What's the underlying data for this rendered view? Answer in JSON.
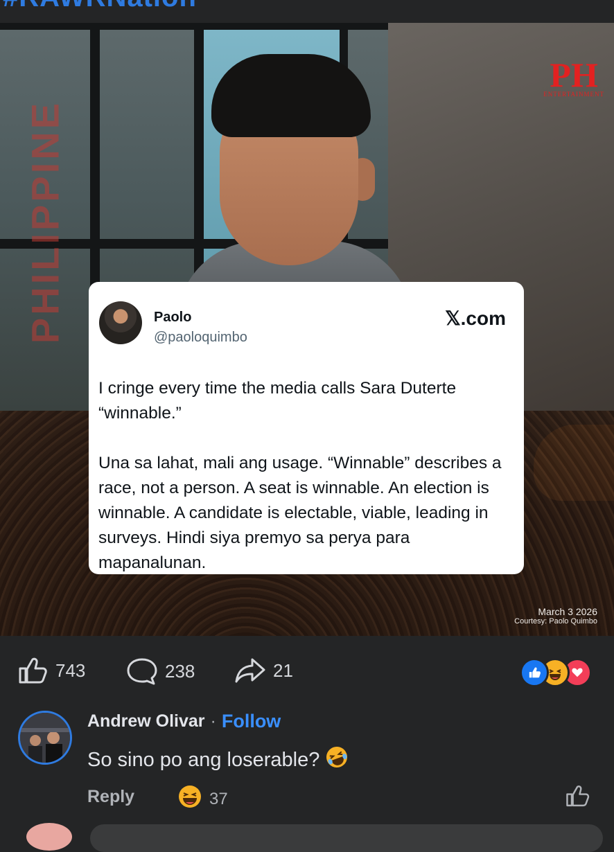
{
  "header": {
    "hashtag": "#RAWRNation"
  },
  "photo": {
    "side_brand": "PHILIPPINE",
    "logo": {
      "letters": "PH",
      "sub": "ENTERTAINMENT"
    },
    "date": "March 3 2026",
    "credit": "Courtesy: Paolo Quimbo"
  },
  "tweet": {
    "name": "Paolo",
    "handle": "@paoloquimbo",
    "source": "𝕏.com",
    "body": "I cringe every time the media calls Sara Duterte “winnable.”\n\nUna sa lahat, mali ang usage. “Winnable” describes a race, not a person. A seat is winnable. An election is winnable. A candidate is electable, viable, leading in surveys. Hindi siya premyo sa perya para mapanalunan."
  },
  "actions": {
    "likes": "743",
    "comments": "238",
    "shares": "21",
    "reaction_icons": [
      "like-reaction-icon",
      "haha-reaction-icon",
      "love-reaction-icon"
    ],
    "colors": {
      "like": "#1877f2",
      "love": "#f33e58",
      "haha": "#f7b125"
    }
  },
  "comment": {
    "author": "Andrew Olivar",
    "separator": "·",
    "follow": "Follow",
    "text": "So sino po ang loserable?",
    "text_emoji": "🤣",
    "reply": "Reply",
    "reaction_emoji": "😁",
    "reaction_count": "37"
  }
}
